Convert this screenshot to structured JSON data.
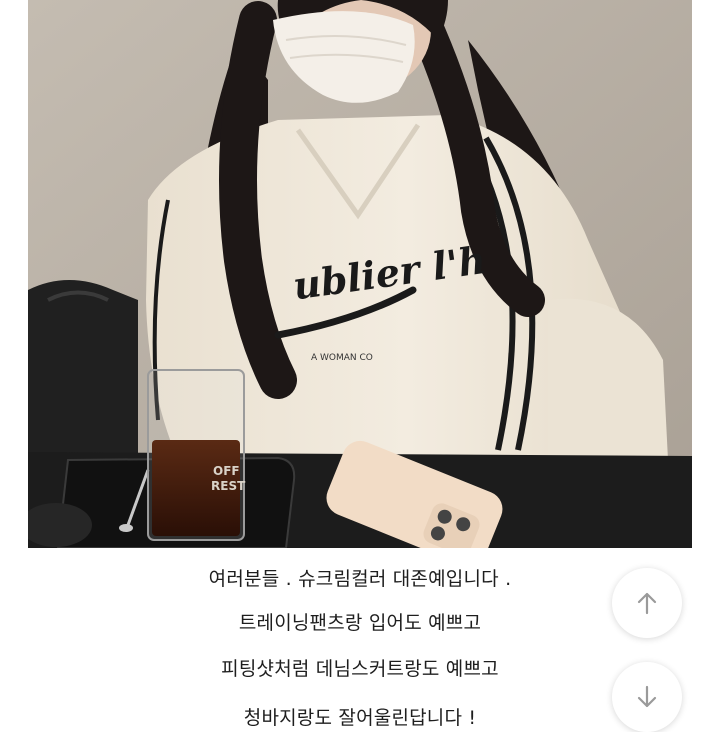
{
  "photo": {
    "alt_label": "product photo",
    "sweatshirt_print": "ublier l'h",
    "sweatshirt_subprint": "A WOMAN CO",
    "cup_print_line1": "OFF",
    "cup_print_line2": "REST"
  },
  "description": {
    "lines": [
      "여러분들 . 슈크림컬러 대존예입니다 .",
      "트레이닝팬츠랑 입어도 예쁘고",
      "피팅샷처럼 데님스커트랑도 예쁘고",
      "청바지랑도 잘어울린답니다 !"
    ]
  },
  "controls": {
    "scroll_up_icon": "arrow-up-icon",
    "scroll_down_icon": "arrow-down-icon"
  },
  "colors": {
    "wall": "#b9b0a5",
    "sweatshirt": "#efe7d8",
    "table": "#1c1c1c",
    "button_arrow": "#9a9a9a"
  }
}
